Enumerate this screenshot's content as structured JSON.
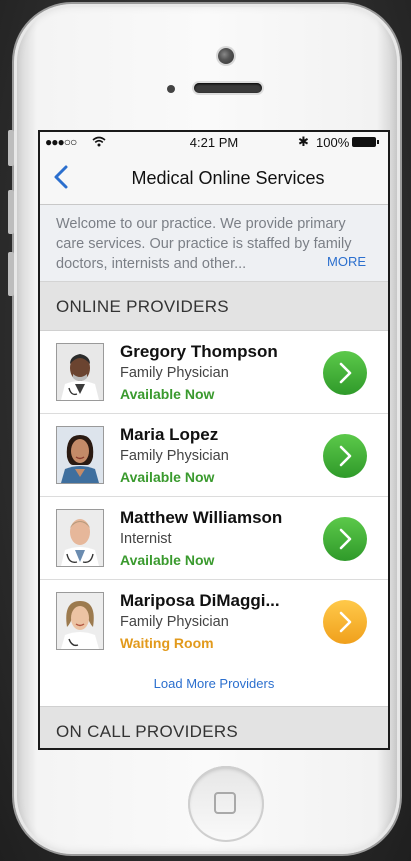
{
  "status_bar": {
    "signal": "●●●○○",
    "time": "4:21 PM",
    "bluetooth": "✱",
    "battery": "100%"
  },
  "nav": {
    "title": "Medical Online Services"
  },
  "welcome": {
    "text": "Welcome to our practice. We provide primary care services. Our practice is staffed by family doctors, internists and other...",
    "more_label": "MORE"
  },
  "sections": {
    "online": "ONLINE PROVIDERS",
    "on_call": "ON CALL PROVIDERS"
  },
  "providers": [
    {
      "name": "Gregory Thompson",
      "role": "Family Physician",
      "status": "Available Now",
      "status_color": "#3a9a2e",
      "button_color": "green"
    },
    {
      "name": "Maria Lopez",
      "role": "Family Physician",
      "status": "Available Now",
      "status_color": "#3a9a2e",
      "button_color": "green"
    },
    {
      "name": "Matthew Williamson",
      "role": "Internist",
      "status": "Available Now",
      "status_color": "#3a9a2e",
      "button_color": "green"
    },
    {
      "name": "Mariposa DiMaggi...",
      "role": "Family Physician",
      "status": "Waiting Room",
      "status_color": "#e29a1c",
      "button_color": "orange"
    }
  ],
  "load_more": "Load More Providers",
  "colors": {
    "accent": "#2b6fce",
    "available": "#3a9a2e",
    "waiting": "#e29a1c"
  }
}
